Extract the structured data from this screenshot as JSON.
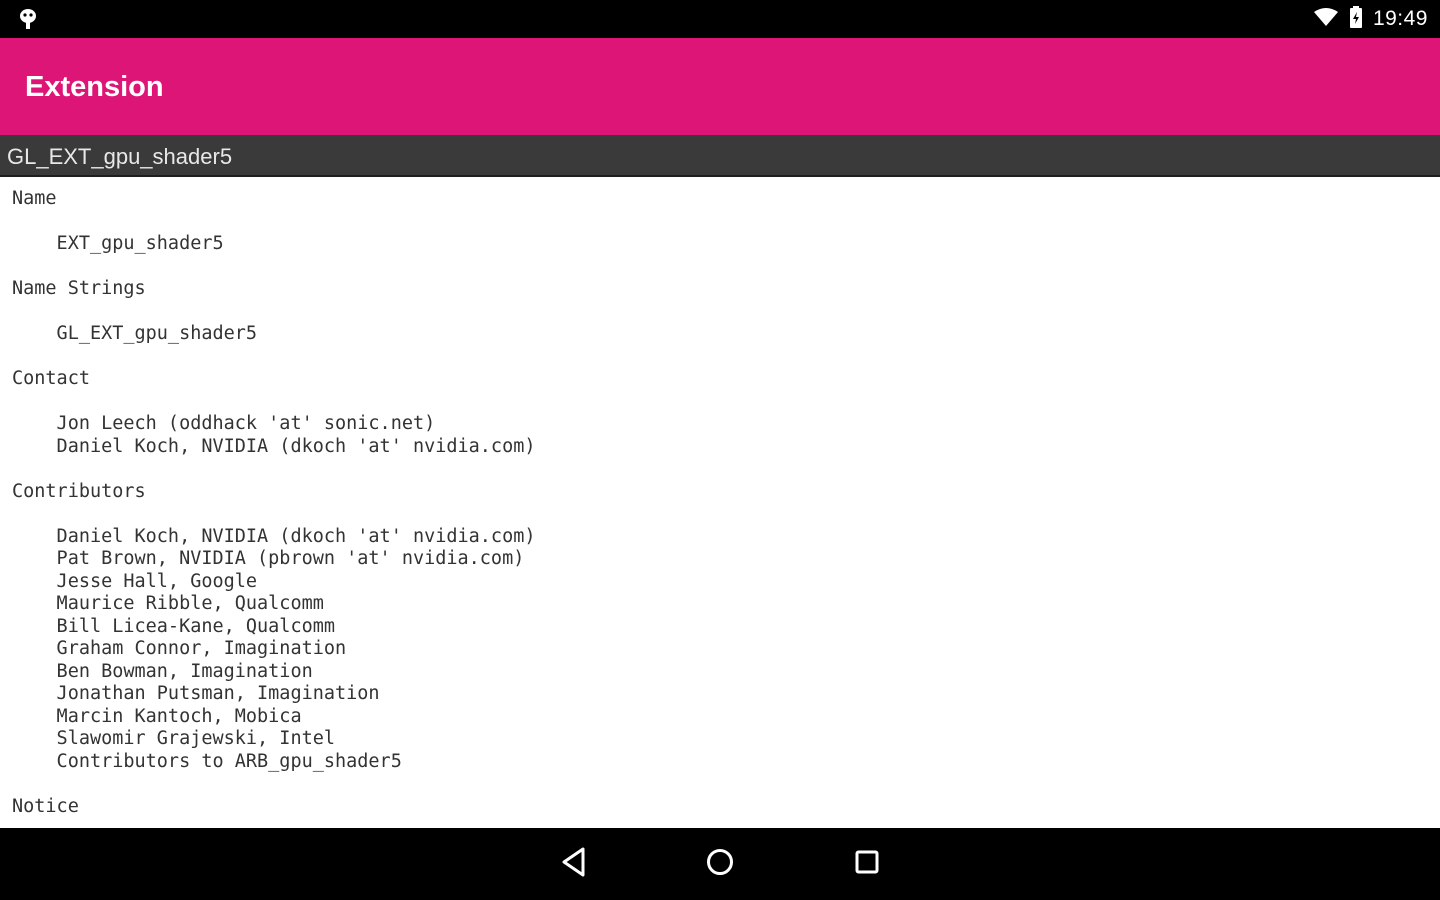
{
  "status_bar": {
    "time": "19:49",
    "left_icon": "android-debug-icon",
    "icons": [
      "wifi-icon",
      "battery-icon"
    ]
  },
  "app_bar": {
    "title": "Extension",
    "color": "#dd1576"
  },
  "extension_header": {
    "name": "GL_EXT_gpu_shader5"
  },
  "spec": {
    "lines": [
      "Name",
      "",
      "    EXT_gpu_shader5",
      "",
      "Name Strings",
      "",
      "    GL_EXT_gpu_shader5",
      "",
      "Contact",
      "",
      "    Jon Leech (oddhack 'at' sonic.net)",
      "    Daniel Koch, NVIDIA (dkoch 'at' nvidia.com)",
      "",
      "Contributors",
      "",
      "    Daniel Koch, NVIDIA (dkoch 'at' nvidia.com)",
      "    Pat Brown, NVIDIA (pbrown 'at' nvidia.com)",
      "    Jesse Hall, Google",
      "    Maurice Ribble, Qualcomm",
      "    Bill Licea-Kane, Qualcomm",
      "    Graham Connor, Imagination",
      "    Ben Bowman, Imagination",
      "    Jonathan Putsman, Imagination",
      "    Marcin Kantoch, Mobica",
      "    Slawomir Grajewski, Intel",
      "    Contributors to ARB_gpu_shader5",
      "",
      "Notice"
    ]
  },
  "nav_bar": {
    "buttons": [
      "back-icon",
      "home-icon",
      "recents-icon"
    ]
  }
}
